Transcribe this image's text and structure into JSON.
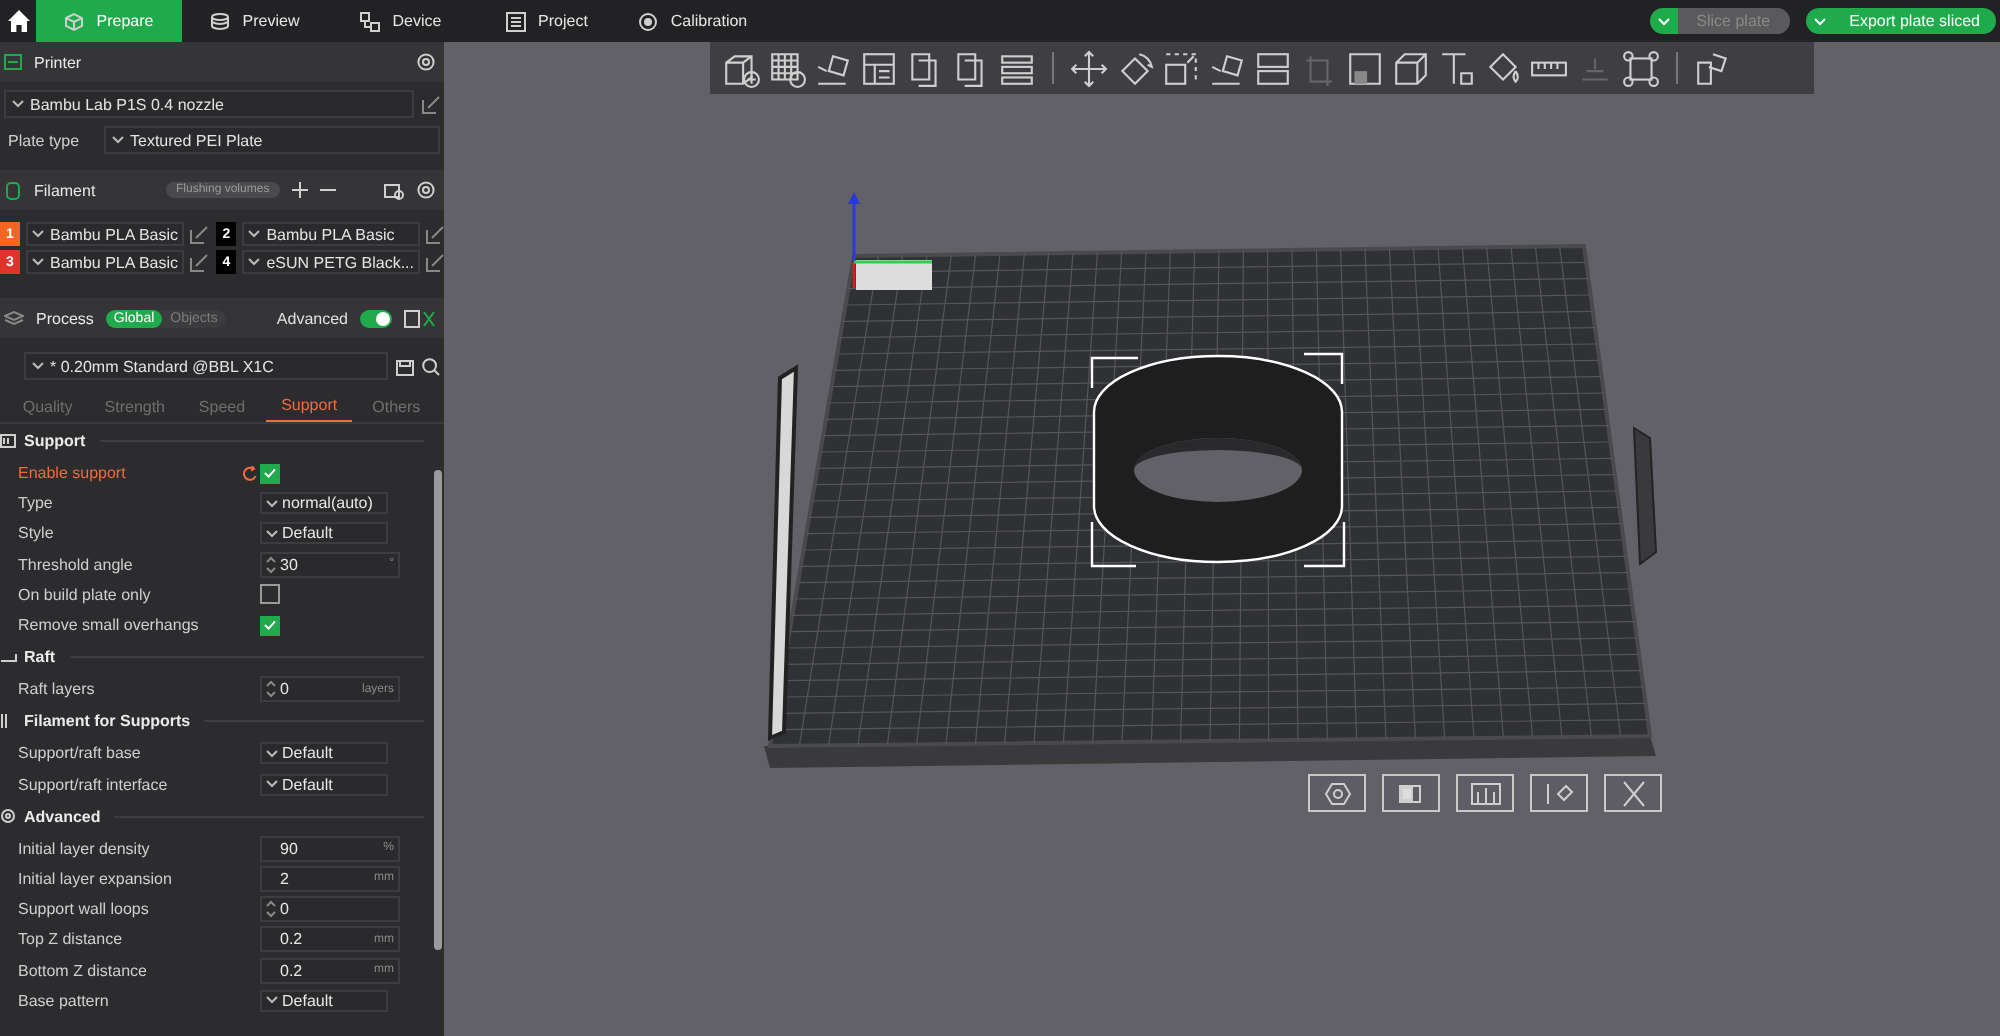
{
  "top_tabs": [
    {
      "label": "Prepare",
      "selected": true
    },
    {
      "label": "Preview",
      "selected": false
    },
    {
      "label": "Device",
      "selected": false
    },
    {
      "label": "Project",
      "selected": false
    },
    {
      "label": "Calibration",
      "selected": false
    }
  ],
  "actions": [
    {
      "label": "Slice plate",
      "disabled": true
    },
    {
      "label": "Export plate sliced",
      "disabled": false
    }
  ],
  "printer": {
    "title": "Printer",
    "preset": "Bambu Lab P1S 0.4 nozzle",
    "plate_type_label": "Plate type",
    "plate_type": "Textured PEI Plate"
  },
  "filament": {
    "title": "Filament",
    "flushing_button": "Flushing volumes",
    "slots": [
      {
        "number": "1",
        "color": "#f26522",
        "name": "Bambu PLA Basic"
      },
      {
        "number": "2",
        "color": "#000000",
        "name": "Bambu PLA Basic"
      },
      {
        "number": "3",
        "color": "#e0342a",
        "name": "Bambu PLA Basic"
      },
      {
        "number": "4",
        "color": "#000000",
        "name": "eSUN PETG Black..."
      }
    ]
  },
  "process": {
    "title": "Process",
    "modes": [
      {
        "label": "Global",
        "selected": true
      },
      {
        "label": "Objects",
        "selected": false
      }
    ],
    "advanced_label": "Advanced",
    "advanced_on": true,
    "preset": "* 0.20mm Standard @BBL X1C",
    "tabs": [
      {
        "label": "Quality",
        "selected": false
      },
      {
        "label": "Strength",
        "selected": false
      },
      {
        "label": "Speed",
        "selected": false
      },
      {
        "label": "Support",
        "selected": true
      },
      {
        "label": "Others",
        "selected": false
      }
    ]
  },
  "settings": [
    {
      "title": "Support",
      "rows": [
        {
          "label": "Enable support",
          "kind": "checkbox",
          "checked": true,
          "modified": true
        },
        {
          "label": "Type",
          "kind": "dropdown",
          "value": "normal(auto)",
          "modified": false
        },
        {
          "label": "Style",
          "kind": "dropdown",
          "value": "Default",
          "modified": false
        },
        {
          "label": "Threshold angle",
          "kind": "spin",
          "value": "30",
          "unit": "°",
          "modified": false
        },
        {
          "label": "On build plate only",
          "kind": "checkbox",
          "checked": false,
          "modified": false
        },
        {
          "label": "Remove small overhangs",
          "kind": "checkbox",
          "checked": true,
          "modified": false
        }
      ]
    },
    {
      "title": "Raft",
      "rows": [
        {
          "label": "Raft layers",
          "kind": "spin",
          "value": "0",
          "unit": "layers",
          "modified": false
        }
      ]
    },
    {
      "title": "Filament for Supports",
      "rows": [
        {
          "label": "Support/raft base",
          "kind": "dropdown",
          "value": "Default",
          "modified": false
        },
        {
          "label": "Support/raft interface",
          "kind": "dropdown",
          "value": "Default",
          "modified": false
        }
      ]
    },
    {
      "title": "Advanced",
      "rows": [
        {
          "label": "Initial layer density",
          "kind": "number",
          "value": "90",
          "unit": "%",
          "modified": false
        },
        {
          "label": "Initial layer expansion",
          "kind": "number",
          "value": "2",
          "unit": "mm",
          "modified": false
        },
        {
          "label": "Support wall loops",
          "kind": "spin",
          "value": "0",
          "modified": false
        },
        {
          "label": "Top Z distance",
          "kind": "number",
          "value": "0.2",
          "unit": "mm",
          "modified": false
        },
        {
          "label": "Bottom Z distance",
          "kind": "number",
          "value": "0.2",
          "unit": "mm",
          "modified": false
        },
        {
          "label": "Base pattern",
          "kind": "dropdown",
          "value": "Default",
          "modified": false
        }
      ]
    }
  ]
}
